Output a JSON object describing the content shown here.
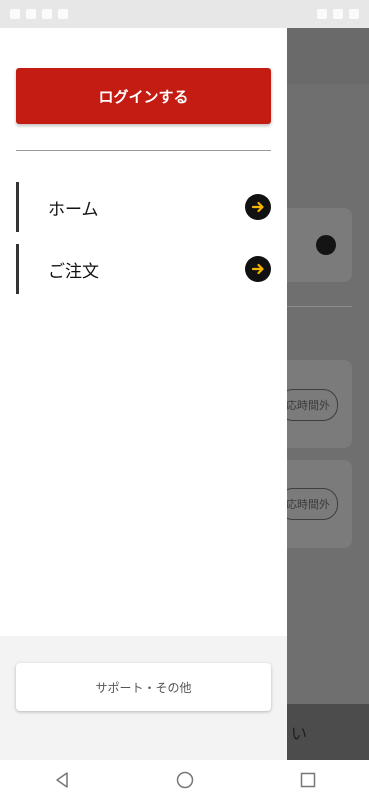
{
  "drawer": {
    "login_label": "ログインする",
    "nav": [
      {
        "label": "ホーム"
      },
      {
        "label": "ご注文"
      }
    ],
    "support_label": "サポート・その他"
  },
  "background": {
    "pill_text": "応時間外",
    "bottom_text": "い"
  },
  "colors": {
    "accent_red": "#c41c12",
    "arrow_yellow": "#f4b400"
  },
  "icons": {
    "nav_arrow": "arrow-right-circle-icon",
    "system": [
      "back-icon",
      "home-icon",
      "recents-icon"
    ]
  }
}
